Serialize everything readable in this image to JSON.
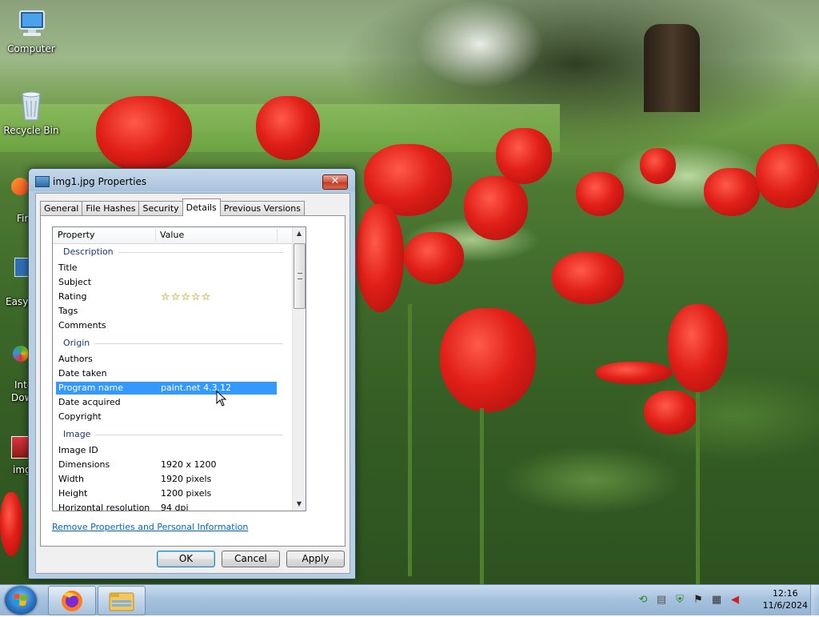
{
  "desktop": {
    "icons": [
      {
        "label": "Computer"
      },
      {
        "label": "Recycle Bin"
      }
    ],
    "partial_labels": [
      "Fir",
      "EasyE",
      "Inte",
      "Dow",
      "img"
    ]
  },
  "dialog": {
    "title": "img1.jpg Properties",
    "close_label": "✕",
    "tabs": [
      "General",
      "File Hashes",
      "Security",
      "Details",
      "Previous Versions"
    ],
    "active_tab": "Details",
    "columns": {
      "property": "Property",
      "value": "Value"
    },
    "groups": {
      "description": "Description",
      "origin": "Origin",
      "image": "Image"
    },
    "rows": [
      {
        "property": "Title",
        "value": ""
      },
      {
        "property": "Subject",
        "value": ""
      },
      {
        "property": "Rating",
        "value": ""
      },
      {
        "property": "Tags",
        "value": ""
      },
      {
        "property": "Comments",
        "value": ""
      },
      {
        "property": "Authors",
        "value": ""
      },
      {
        "property": "Date taken",
        "value": ""
      },
      {
        "property": "Program name",
        "value": "paint.net 4.3.12"
      },
      {
        "property": "Date acquired",
        "value": ""
      },
      {
        "property": "Copyright",
        "value": ""
      },
      {
        "property": "Image ID",
        "value": ""
      },
      {
        "property": "Dimensions",
        "value": "1920 x 1200"
      },
      {
        "property": "Width",
        "value": "1920 pixels"
      },
      {
        "property": "Height",
        "value": "1200 pixels"
      },
      {
        "property": "Horizontal resolution",
        "value": "94 dpi"
      }
    ],
    "rating_stars": "☆☆☆☆☆",
    "rating_value": 0,
    "remove_link": "Remove Properties and Personal Information",
    "buttons": {
      "ok": "OK",
      "cancel": "Cancel",
      "apply": "Apply"
    }
  },
  "taskbar": {
    "clock_time": "12:16",
    "clock_date": "11/6/2024"
  }
}
